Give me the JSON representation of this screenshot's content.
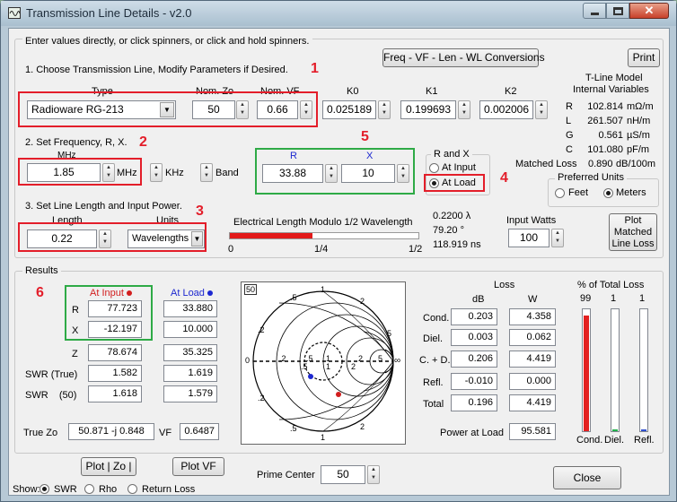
{
  "window": {
    "title": "Transmission Line Details - v2.0"
  },
  "instructions": "Enter values directly, or click spinners, or click and hold spinners.",
  "buttons": {
    "conversions": "Freq - VF - Len - WL Conversions",
    "print": "Print",
    "band": "Band",
    "plot_matched": "Plot Matched Line Loss",
    "plot_zo": "Plot | Zo |",
    "plot_vf": "Plot VF",
    "close": "Close"
  },
  "section1": {
    "label": "1. Choose Transmission Line, Modify Parameters if Desired.",
    "type_label": "Type",
    "type_value": "Radioware RG-213",
    "zo_label": "Nom. Zo",
    "zo_value": "50",
    "vf_label": "Nom. VF",
    "vf_value": "0.66",
    "k0_label": "K0",
    "k0_value": "0.025189",
    "k1_label": "K1",
    "k1_value": "0.199693",
    "k2_label": "K2",
    "k2_value": "0.002006"
  },
  "section2": {
    "label": "2. Set Frequency, R, X.",
    "mhz_label": "MHz",
    "freq_value": "1.85",
    "mhz_btn": "MHz",
    "khz_btn": "KHz",
    "r_label": "R",
    "r_value": "33.88",
    "x_label": "X",
    "x_value": "10",
    "rx_title": "R and X",
    "at_input": "At Input",
    "at_load": "At Load"
  },
  "section3": {
    "label": "3. Set Line Length and Input Power.",
    "length_label": "Length",
    "length_value": "0.22",
    "units_label": "Units",
    "units_value": "Wavelengths",
    "elec_label": "Electrical Length Modulo 1/2 Wavelength",
    "elec_fraction": 0.44,
    "scale_0": "0",
    "scale_q": "1/4",
    "scale_h": "1/2",
    "wl": "0.2200 λ",
    "deg": "79.20 °",
    "ns": "118.919 ns",
    "watts_label": "Input Watts",
    "watts_value": "100"
  },
  "model": {
    "title1": "T-Line Model",
    "title2": "Internal Variables",
    "rows": [
      {
        "k": "R",
        "v": "102.814",
        "u": "mΩ/m"
      },
      {
        "k": "L",
        "v": "261.507",
        "u": "nH/m"
      },
      {
        "k": "G",
        "v": "0.561",
        "u": "µS/m"
      },
      {
        "k": "C",
        "v": "101.080",
        "u": "pF/m"
      }
    ],
    "ml_label": "Matched Loss",
    "ml_value": "0.890",
    "ml_unit": "dB/100m"
  },
  "units": {
    "title": "Preferred Units",
    "feet": "Feet",
    "meters": "Meters"
  },
  "callouts": [
    "1",
    "2",
    "3",
    "4",
    "5",
    "6"
  ],
  "results": {
    "title": "Results",
    "at_input": "At Input",
    "at_load": "At Load",
    "rows": [
      {
        "label": "R",
        "input": "77.723",
        "load": "33.880"
      },
      {
        "label": "X",
        "input": "-12.197",
        "load": "10.000"
      },
      {
        "label": "Z",
        "input": "78.674",
        "load": "35.325"
      },
      {
        "label": "SWR  (True)",
        "input": "1.582",
        "load": "1.619"
      },
      {
        "label": "SWR    (50)",
        "input": "1.618",
        "load": "1.579"
      }
    ],
    "true_zo_label": "True Zo",
    "true_zo_value": "50.871 -j 0.848",
    "vf_label": "VF",
    "vf_value": "0.6487"
  },
  "smith": {
    "zo": "50",
    "labels": [
      ".5",
      "1",
      "2",
      ".2",
      "5",
      ".2",
      ".5",
      "1",
      "2",
      ".5",
      "1",
      "2",
      "0",
      ".2",
      ".5",
      "1",
      "2",
      "5",
      "∞"
    ]
  },
  "loss": {
    "title": "Loss",
    "db": "dB",
    "w": "W",
    "rows": [
      {
        "label": "Cond.",
        "db": "0.203",
        "w": "4.358"
      },
      {
        "label": "Diel.",
        "db": "0.003",
        "w": "0.062"
      },
      {
        "label": "C. + D.",
        "db": "0.206",
        "w": "4.419"
      },
      {
        "label": "Refl.",
        "db": "-0.010",
        "w": "0.000"
      },
      {
        "label": "Total",
        "db": "0.196",
        "w": "4.419"
      }
    ],
    "pal_label": "Power at Load",
    "pal_value": "95.581"
  },
  "pct": {
    "title": "% of Total Loss",
    "bars": [
      {
        "value": "99",
        "label": "Cond.",
        "pct": 0.99,
        "color": "#e32020"
      },
      {
        "value": "1",
        "label": "Diel.",
        "pct": 0.01,
        "color": "#22b14c"
      },
      {
        "value": "1",
        "label": "Refl.",
        "pct": 0.01,
        "color": "#3050d0"
      }
    ]
  },
  "prime": {
    "label": "Prime Center",
    "value": "50"
  },
  "show": {
    "label": "Show:",
    "swr": "SWR",
    "rho": "Rho",
    "return_loss": "Return Loss"
  },
  "colors": {
    "accent_red": "#e31e2a",
    "accent_green": "#2eaa46",
    "load_blue": "#1d28d0"
  }
}
